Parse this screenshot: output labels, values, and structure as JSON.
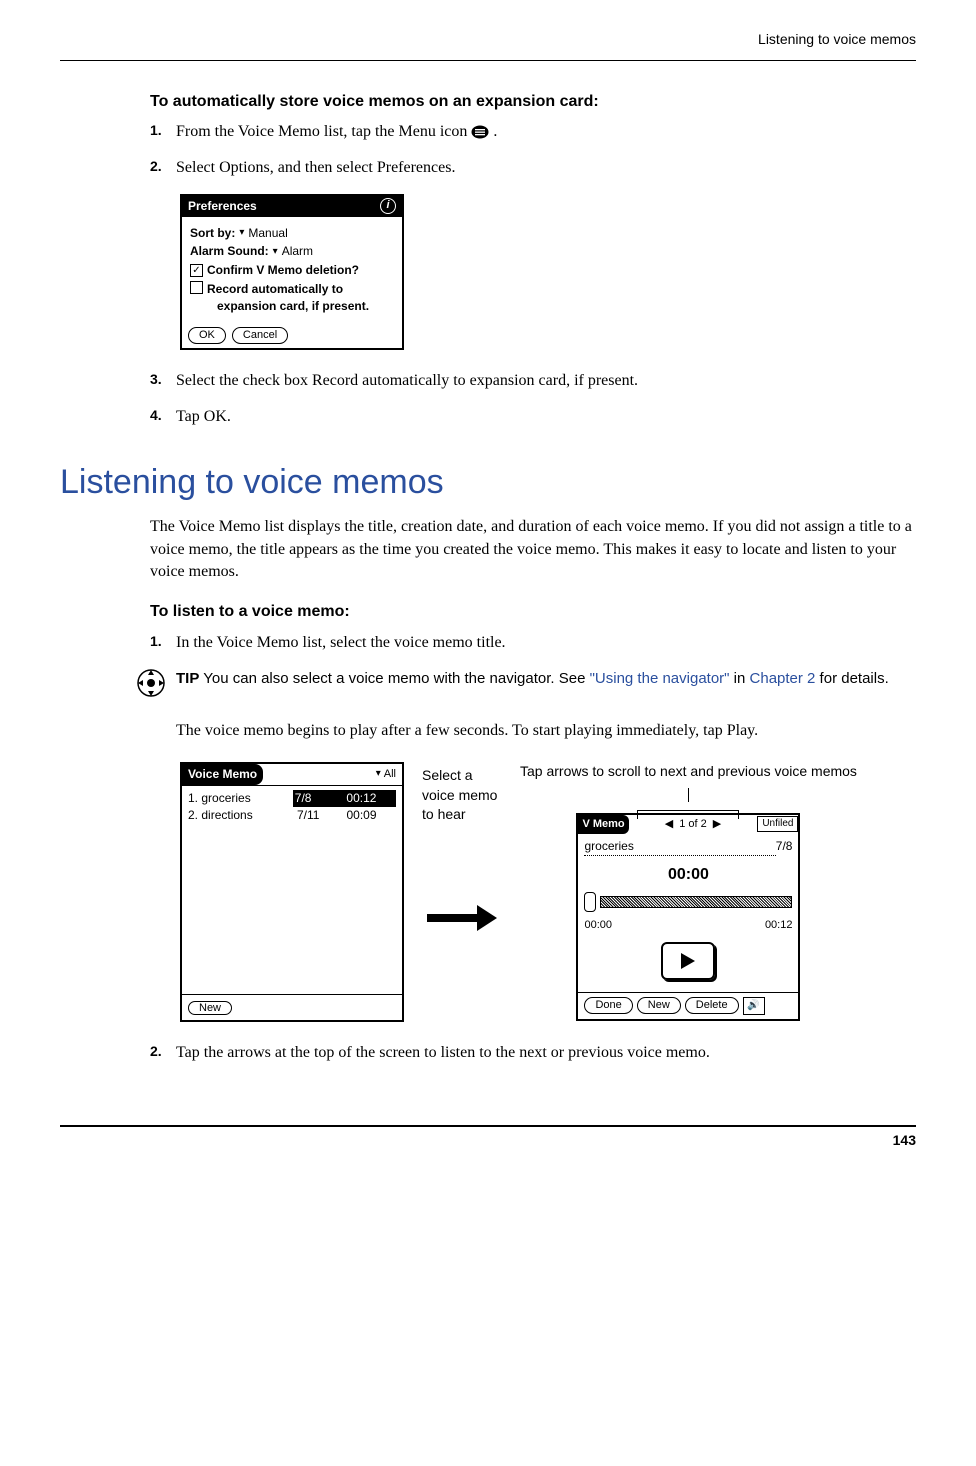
{
  "header": {
    "running_head": "Listening to voice memos"
  },
  "section_a": {
    "subhead": "To automatically store voice memos on an expansion card:",
    "steps": [
      {
        "num": "1.",
        "text_a": "From the Voice Memo list, tap the Menu icon ",
        "text_b": "."
      },
      {
        "num": "2.",
        "text": "Select Options, and then select Preferences."
      }
    ],
    "prefs": {
      "title": "Preferences",
      "sort_label": "Sort by:",
      "sort_value": "Manual",
      "alarm_label": "Alarm Sound:",
      "alarm_value": "Alarm",
      "confirm_label": "Confirm V Memo deletion?",
      "record_label_l1": "Record automatically to",
      "record_label_l2": "expansion card, if present.",
      "ok": "OK",
      "cancel": "Cancel"
    },
    "steps2": [
      {
        "num": "3.",
        "text": "Select the check box Record automatically to expansion card, if present."
      },
      {
        "num": "4.",
        "text": "Tap OK."
      }
    ]
  },
  "section_b": {
    "title": "Listening to voice memos",
    "intro": "The Voice Memo list displays the title, creation date, and duration of each voice memo. If you did not assign a title to a voice memo, the title appears as the time you created the voice memo. This makes it easy to locate and listen to your voice memos.",
    "subhead": "To listen to a voice memo:",
    "step1": {
      "num": "1.",
      "text": "In the Voice Memo list, select the voice memo title."
    },
    "tip": {
      "label": "TIP",
      "text_a": "You can also select a voice memo with the navigator. See ",
      "link1": "\"Using the navigator\"",
      "mid": " in ",
      "link2": "Chapter 2",
      "text_b": " for details."
    },
    "after_tip": "The voice memo begins to play after a few seconds. To start playing immediately, tap Play.",
    "list_fig": {
      "title": "Voice Memo",
      "category": "All",
      "rows": [
        {
          "n": "1.",
          "title": "groceries",
          "date": "7/8",
          "dur": "00:12"
        },
        {
          "n": "2.",
          "title": "directions",
          "date": "7/11",
          "dur": "00:09"
        }
      ],
      "new": "New"
    },
    "mid_label": "Select a voice memo to hear",
    "play_caption": "Tap arrows to scroll to next and previous voice memos",
    "play_fig": {
      "title": "V Memo",
      "nav": "1 of 2",
      "category": "Unfiled",
      "memo_title": "groceries",
      "memo_date": "7/8",
      "big_time": "00:00",
      "start": "00:00",
      "end": "00:12",
      "done": "Done",
      "new": "New",
      "delete": "Delete"
    },
    "step2": {
      "num": "2.",
      "text": "Tap the arrows at the top of the screen to listen to the next or previous voice memo."
    }
  },
  "footer": {
    "page": "143"
  }
}
